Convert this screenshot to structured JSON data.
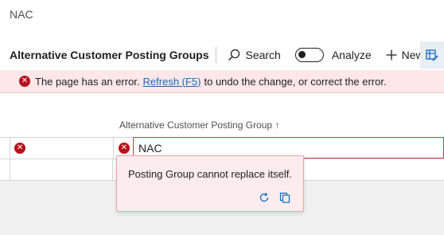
{
  "breadcrumb": {
    "text": "NAC"
  },
  "toolbar": {
    "title": "Alternative Customer Posting Groups",
    "search_label": "Search",
    "analyze_label": "Analyze",
    "new_label": "New"
  },
  "error_bar": {
    "prefix": "The page has an error.",
    "link": "Refresh (F5)",
    "suffix": "to undo the change, or correct the error."
  },
  "grid": {
    "column_header": "Alternative Customer Posting Group ↑",
    "rows": [
      {
        "value": "NAC",
        "has_error": true
      }
    ]
  },
  "validation_popup": {
    "message": "Posting Group cannot replace itself."
  },
  "colors": {
    "error_red": "#b5121b",
    "error_bg": "#fde7e9",
    "link_blue": "#0f6cbd"
  }
}
